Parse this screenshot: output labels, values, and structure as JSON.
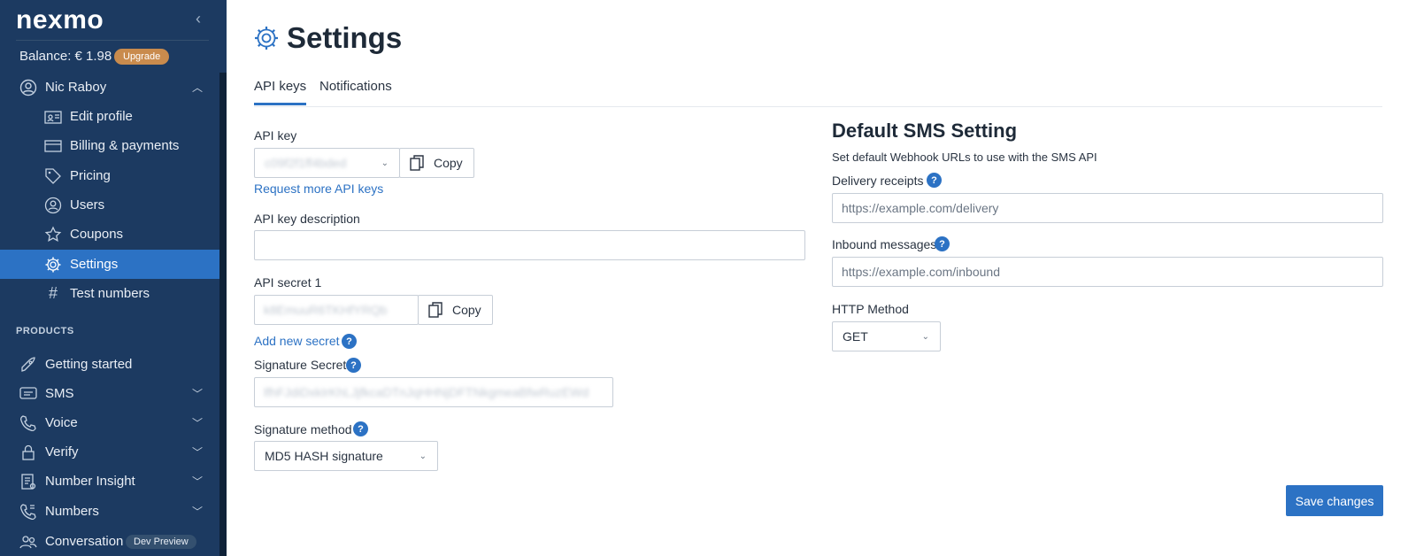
{
  "app": {
    "logo_text": "nexmo",
    "collapse_icon": "chevron-left-icon"
  },
  "account": {
    "balance_label": "Balance: € 1.98",
    "upgrade_label": "Upgrade"
  },
  "sidebar": {
    "user_name": "Nic Raboy",
    "items": [
      {
        "label": "Edit profile",
        "icon": "id-card-icon"
      },
      {
        "label": "Billing & payments",
        "icon": "credit-card-icon"
      },
      {
        "label": "Pricing",
        "icon": "tag-icon"
      },
      {
        "label": "Users",
        "icon": "users-icon"
      },
      {
        "label": "Coupons",
        "icon": "star-icon"
      },
      {
        "label": "Settings",
        "icon": "gear-icon",
        "active": true
      },
      {
        "label": "Test numbers",
        "icon": "hash-icon"
      }
    ],
    "products_heading": "PRODUCTS",
    "products": [
      {
        "label": "Getting started",
        "icon": "rocket-icon"
      },
      {
        "label": "SMS",
        "icon": "message-icon"
      },
      {
        "label": "Voice",
        "icon": "phone-icon"
      },
      {
        "label": "Verify",
        "icon": "lock-icon"
      },
      {
        "label": "Number Insight",
        "icon": "document-icon"
      },
      {
        "label": "Numbers",
        "icon": "phone-book-icon"
      },
      {
        "label": "Conversation",
        "icon": "people-icon",
        "badge": "Dev Preview"
      }
    ]
  },
  "page": {
    "title": "Settings"
  },
  "tabs": [
    {
      "label": "API keys"
    },
    {
      "label": "Notifications"
    }
  ],
  "api": {
    "key_label": "API key",
    "key_value": "c09f2f1ff4bded",
    "copy_label": "Copy",
    "request_more": "Request more API keys",
    "desc_label": "API key description",
    "desc_value": "",
    "secret_label": "API secret 1",
    "secret_value": "k8EmuuR6TKHfYRQb",
    "add_secret": "Add new secret",
    "sig_secret_label": "Signature Secret",
    "sig_secret_value": "lfhFJdiDxkIrKhLJjfkcaDTnJqHHNjDFTNkgmeaBfwRuzEWd",
    "sig_method_label": "Signature method",
    "sig_method_value": "MD5 HASH signature",
    "help_glyph": "?"
  },
  "sms": {
    "heading": "Default SMS Setting",
    "description": "Set default Webhook URLs to use with the SMS API",
    "delivery_label": "Delivery receipts",
    "delivery_placeholder": "https://example.com/delivery",
    "inbound_label": "Inbound messages",
    "inbound_placeholder": "https://example.com/inbound",
    "http_label": "HTTP Method",
    "http_value": "GET"
  },
  "actions": {
    "save_label": "Save changes"
  },
  "colors": {
    "sidebar": "#1c3a61",
    "accent": "#2c72c4",
    "upgrade": "#c98b4d"
  }
}
